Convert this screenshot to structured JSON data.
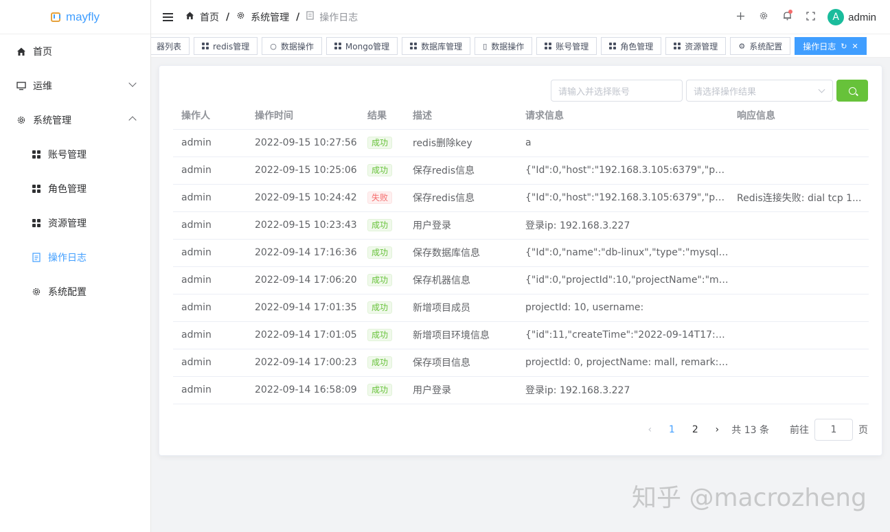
{
  "app": {
    "name": "mayfly"
  },
  "sidebar": {
    "items": [
      {
        "label": "首页"
      },
      {
        "label": "运维"
      },
      {
        "label": "系统管理"
      },
      {
        "label": "账号管理"
      },
      {
        "label": "角色管理"
      },
      {
        "label": "资源管理"
      },
      {
        "label": "操作日志"
      },
      {
        "label": "系统配置"
      }
    ]
  },
  "header": {
    "breadcrumb": [
      "首页",
      "系统管理",
      "操作日志"
    ],
    "user": {
      "avatar": "A",
      "name": "admin"
    }
  },
  "tags": [
    "器列表",
    "redis管理",
    "数据操作",
    "Mongo管理",
    "数据库管理",
    "数据操作",
    "账号管理",
    "角色管理",
    "资源管理",
    "系统配置",
    "操作日志"
  ],
  "filters": {
    "account_placeholder": "请输入并选择账号",
    "result_placeholder": "请选择操作结果"
  },
  "table": {
    "columns": [
      "操作人",
      "操作时间",
      "结果",
      "描述",
      "请求信息",
      "响应信息"
    ],
    "rows": [
      [
        "admin",
        "2022-09-15 10:27:56",
        "成功",
        "redis删除key",
        "a",
        ""
      ],
      [
        "admin",
        "2022-09-15 10:25:06",
        "成功",
        "保存redis信息",
        "{\"Id\":0,\"host\":\"192.168.3.105:6379\",\"pass...",
        ""
      ],
      [
        "admin",
        "2022-09-15 10:24:42",
        "失败",
        "保存redis信息",
        "{\"Id\":0,\"host\":\"192.168.3.105:6379\",\"pass...",
        "Redis连接失败: dial tcp 1..."
      ],
      [
        "admin",
        "2022-09-15 10:23:43",
        "成功",
        "用户登录",
        "登录ip: 192.168.3.227",
        ""
      ],
      [
        "admin",
        "2022-09-14 17:16:36",
        "成功",
        "保存数据库信息",
        "{\"Id\":0,\"name\":\"db-linux\",\"type\":\"mysql\",...",
        ""
      ],
      [
        "admin",
        "2022-09-14 17:06:20",
        "成功",
        "保存机器信息",
        "{\"id\":0,\"projectId\":10,\"projectName\":\"ma...",
        ""
      ],
      [
        "admin",
        "2022-09-14 17:01:35",
        "成功",
        "新增项目成员",
        "projectId: 10, username:",
        ""
      ],
      [
        "admin",
        "2022-09-14 17:01:05",
        "成功",
        "新增项目环境信息",
        "{\"id\":11,\"createTime\":\"2022-09-14T17:01...",
        ""
      ],
      [
        "admin",
        "2022-09-14 17:00:23",
        "成功",
        "保存项目信息",
        "projectId: 0, projectName: mall, remark: ...",
        ""
      ],
      [
        "admin",
        "2022-09-14 16:58:09",
        "成功",
        "用户登录",
        "登录ip: 192.168.3.227",
        ""
      ]
    ]
  },
  "pagination": {
    "pages": [
      "1",
      "2"
    ],
    "total": "共 13 条",
    "goto_prefix": "前往",
    "goto_value": "1",
    "goto_suffix": "页"
  },
  "watermark": "知乎 @macrozheng",
  "colors": {
    "primary": "#409eff",
    "success": "#67c23a",
    "danger": "#f56c6c"
  }
}
